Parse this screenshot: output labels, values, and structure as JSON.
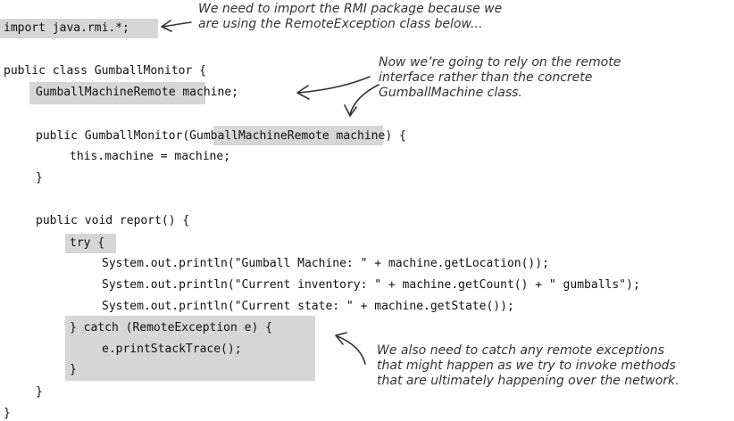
{
  "code_lines": [
    "import java.rmi.*;",
    "public class GumballMonitor {",
    "GumballMachineRemote machine;",
    "public GumballMonitor(GumballMachineRemote machine) {",
    "this.machine = machine;",
    "}",
    "public void report() {",
    "try {",
    "System.out.println(\"Gumball Machine: \" + machine.getLocation());",
    "System.out.println(\"Current inventory: \" + machine.getCount() + \" gumballs\");",
    "System.out.println(\"Current state: \" + machine.getState());",
    "} catch (RemoteException e) {",
    "e.printStackTrace();",
    "}",
    "}",
    "}"
  ],
  "annotations": {
    "import_note": "We need to import the RMI package because we\nare using the RemoteException class below...",
    "remote_note": "Now we’re going to rely on the remote\ninterface rather than the concrete\nGumballMachine class.",
    "catch_note": "We also need to catch any remote exceptions\nthat might happen as we try to invoke methods\nthat are ultimately happening over the network."
  },
  "colors": {
    "highlight": "#d6d6d6",
    "code_text": "#111111",
    "note_text": "#333333"
  }
}
